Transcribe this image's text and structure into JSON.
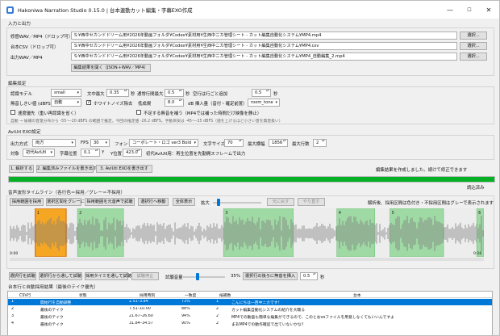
{
  "window": {
    "title": "Hakoniwa Narration Studio 0.15.0 | 台本連動カット編集・字幕EXO作成",
    "minimize": "—",
    "maximize": "☐",
    "close": "✕"
  },
  "io": {
    "section": "入力と出力",
    "video_label": "修督WAV／MP4（ドロップ可）",
    "video_value": "S:¥西中セカンドドリーム用¥2026年動画フォルダ¥Codex¥素材用¥生西中ニカ管理シート - カット編集自動化システム¥MP4.mp4",
    "csv_label": "台本CSV（ドロップ可）",
    "csv_value": "S:¥西中セカンドドリーム用¥2026年動画フォルダ¥Codex¥素材用¥生西中ニカ管理シート - カット編集自動化システム¥MP4.csv",
    "out_label": "出力WAV／MP4",
    "out_value": "S:¥西中セカンドドリーム用¥2026年動画フォルダ¥Codex¥素材用¥生西中ニカ管理シート - カット編集自動化システム¥MP4_自動編集_2.mp4",
    "choose": "選択...",
    "open_result": "編集結果を開く（JSON＋WAV／MP4）"
  },
  "edit": {
    "section": "編集設定",
    "model_label": "認識モデル",
    "model_value": "small",
    "char_max_label": "文中最大",
    "char_max_value": "0.35",
    "sec": "秒",
    "line_max_label": "通常行間最大",
    "line_max_value": "0.5",
    "empty_label": "空行は行ごと追加",
    "empty_value": "0.5",
    "sil_label": "無音しきい値 (dBFS)",
    "sil_value": "自動",
    "noise_label": "ホワイトノイズ除去",
    "loud_label": "低成規",
    "loud_value": "8.0",
    "db_label": "dB 挿入量（音付・確定前置）",
    "db_value": "room_tone",
    "speed_label": "速度優先（重い再認識を省く）",
    "fill_label": "不足する無音を補う（MP4では補った時間だけ映像を静止）",
    "hint": "自動 → 候補の音量分布から -55〜-20 dBFS の範囲で推定。今回の推定値 -26.2 dBFS。手動目安は -45〜-25 dBFS（値を上げるほど小さい音を無音扱い）"
  },
  "aviutl": {
    "section": "AviUtl EXO設定",
    "output_label": "出力方式",
    "output_value": "両方",
    "fps_label": "FPS",
    "fps_value": "30",
    "font_label": "フォント",
    "font_value": "コーポレート・ロゴ ver3 Bold",
    "size_label": "文字サイズ",
    "size_value": "70",
    "width_label": "最大横幅",
    "width_value": "1856",
    "lines_label": "最大行数",
    "lines_value": "2",
    "target_label": "対象",
    "target_value": "初代AviUtl",
    "pos_label": "字幕位置",
    "pos_value": "0.1",
    "pos_unit": "Y",
    "ycoord_label": "Y位置",
    "ycoord_value": "423.0",
    "note": "初代AviUtl用：再生位置を先勤開スフレームで出力"
  },
  "steps": {
    "step1": "1. 解析する",
    "step2": "2. 編集済みファイルを書き出す",
    "step3": "3. AviUtl EXOを書き出す",
    "status": "編集結果を作成しました。続けて修正できます",
    "progress_label": "読込済み",
    "progress": 1.0
  },
  "waveform": {
    "section": "音声波形タイムライン（各行色＝採用／グレー＝不採用）",
    "btn_adopt": "採用範囲を採用",
    "btn_gray": "選択区間をグレーに",
    "btn_restore": "採用範囲を元音声で試聴",
    "btn_move": "選択行へ移動",
    "btn_all": "全体表示",
    "zoom_label": "拡大",
    "undo": "元に戻す",
    "redo": "やり直す",
    "note": "解析後、採用区間は色付き・不採用区間はグレーで表示されます",
    "time_start": "0:00",
    "time_end": "0:16",
    "regions": [
      {
        "label": "1",
        "selected": true,
        "start": 0.054,
        "end": 0.119
      },
      {
        "label": "2",
        "selected": false,
        "start": 0.143,
        "end": 0.24
      },
      {
        "label": "3",
        "selected": false,
        "start": 0.451,
        "end": 0.598
      },
      {
        "label": "4",
        "selected": false,
        "start": 0.69,
        "end": 0.77
      },
      {
        "label": "5",
        "selected": false,
        "start": 0.802,
        "end": 0.915
      },
      {
        "label": "6",
        "selected": false,
        "start": 0.985,
        "end": 1.0
      }
    ]
  },
  "preview": {
    "btn_adopt": "選択行を試聴",
    "btn_from": "選択行から通して試聴",
    "btn_through": "採用タイミを通して試聴",
    "stop": "試聴停止",
    "vol_label": "試聴音量",
    "vol_value": "35%",
    "vol": 0.35,
    "insert_label": "選択行の後ろに無音を挿入",
    "insert_value": "0.5",
    "sec": "秒"
  },
  "table": {
    "section": "台本行と自動採用結果（最後のテイク優先）",
    "headers": [
      "CSV行",
      "状態",
      "採用時刻",
      "一致度",
      "候補数",
      "台本"
    ],
    "rows": [
      {
        "csv": "1",
        "state": "開始行を自動調整",
        "time": "2.51–3.84",
        "match": "73%",
        "cands": "1",
        "text": "こんにちは一西中ニカです！"
      },
      {
        "csv": "2",
        "state": "最後のテイク",
        "time": "7.51–10.00",
        "match": "88%",
        "cands": "2",
        "text": "カット編集自動化システムの紹介を大聴る"
      },
      {
        "csv": "3",
        "state": "最後のテイク",
        "time": "21.67–26.60",
        "match": "94%",
        "cands": "2",
        "text": "MP4での動画も簡単な編集ができるので、このとおvoファイルを用意しなくてもいいんですよ"
      },
      {
        "csv": "4",
        "state": "最後のテイク",
        "time": "31.84–34.57",
        "match": "90%",
        "cands": "2",
        "text": "まあMP4での動作確認で出ていないかな？"
      }
    ]
  },
  "colors": {
    "accent": "#0078d7",
    "progress": "#06b025",
    "region": "#9fd9a4",
    "region_sel": "#f5a623"
  }
}
